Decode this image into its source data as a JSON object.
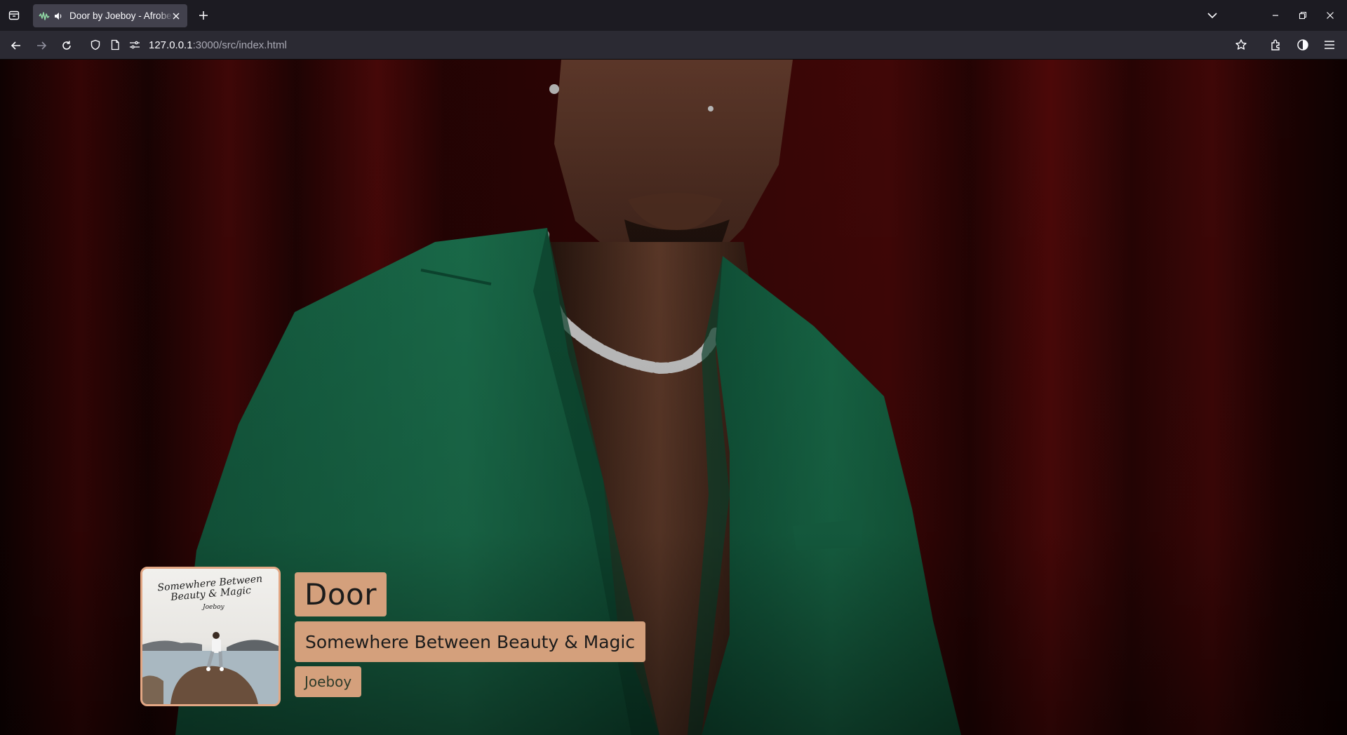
{
  "browser": {
    "tab": {
      "title": "Door by Joeboy - Afrobeats",
      "favicon": "music-wave-icon",
      "audio": "speaker-playing-icon"
    },
    "url": {
      "host": "127.0.0.1",
      "rest": ":3000/src/index.html"
    }
  },
  "player": {
    "song_title": "Door",
    "album_title": "Somewhere Between Beauty & Magic",
    "artist": "Joeboy",
    "cover_art": {
      "title_lines": [
        "Somewhere Between",
        "Beauty & Magic"
      ],
      "signature": "Joeboy"
    }
  },
  "colors": {
    "label_bg": "#d4a07c",
    "cover_border": "#e3a784",
    "curtain_red": "#5a0b0b",
    "jacket_green": "#1f7a56"
  }
}
